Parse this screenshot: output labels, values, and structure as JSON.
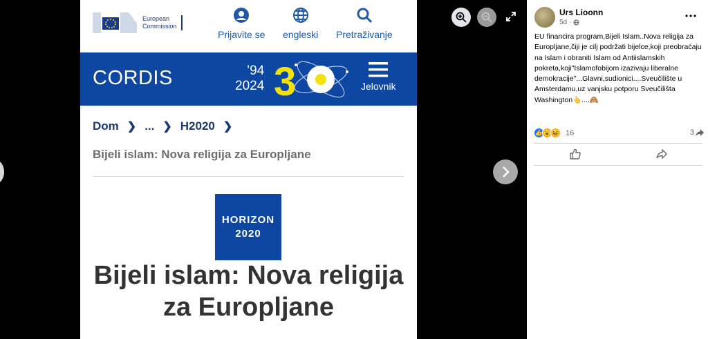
{
  "viewer": {
    "zoom_in": "zoom-in-icon",
    "zoom_out": "zoom-out-icon",
    "fullscreen": "fullscreen-icon",
    "next": "chevron-right-icon",
    "prev": "chevron-left-icon"
  },
  "shot": {
    "ec_logo": {
      "line1": "European",
      "line2": "Commission"
    },
    "nav": [
      {
        "label": "Prijavite se",
        "icon": "user-icon"
      },
      {
        "label": "engleski",
        "icon": "globe-icon"
      },
      {
        "label": "Pretraživanje",
        "icon": "search-icon"
      }
    ],
    "cordis": {
      "title": "CORDIS",
      "year1": "’94",
      "year2": "2024",
      "anniversary": "30",
      "menu_label": "Jelovnik"
    },
    "breadcrumb": [
      "Dom",
      "...",
      "H2020"
    ],
    "subtitle": "Bijeli islam: Nova religija za Europljane",
    "horizon": {
      "line1": "HORIZON",
      "line2": "2020"
    },
    "title_line1": "Bijeli islam: Nova religija",
    "title_line2": "za Europljane",
    "colors": {
      "cordis_blue": "#0e47a1",
      "accent_yellow": "#f3e20a",
      "link_blue": "#1e5aa8"
    }
  },
  "post": {
    "author": "Urs Lioonn",
    "time": "5d",
    "privacy_icon": "globe-icon",
    "text": "EU financira program,Bijeli Islam..Nova religija za Europljane,čiji je cilj podržati bijelce,koji preobraćaju na Islam i obraniti Islam od Antiislamskih pokreta,koji\"Islamofobijom izazivaju liberalne demokracije\"...Glavni,sudionici....Sveučilište u Amsterdamu,uz vanjsku potporu Sveučilišta Washington👆....🙈",
    "reaction_count": "16",
    "share_count": "3",
    "reactions": [
      "like",
      "wow",
      "haha"
    ]
  }
}
